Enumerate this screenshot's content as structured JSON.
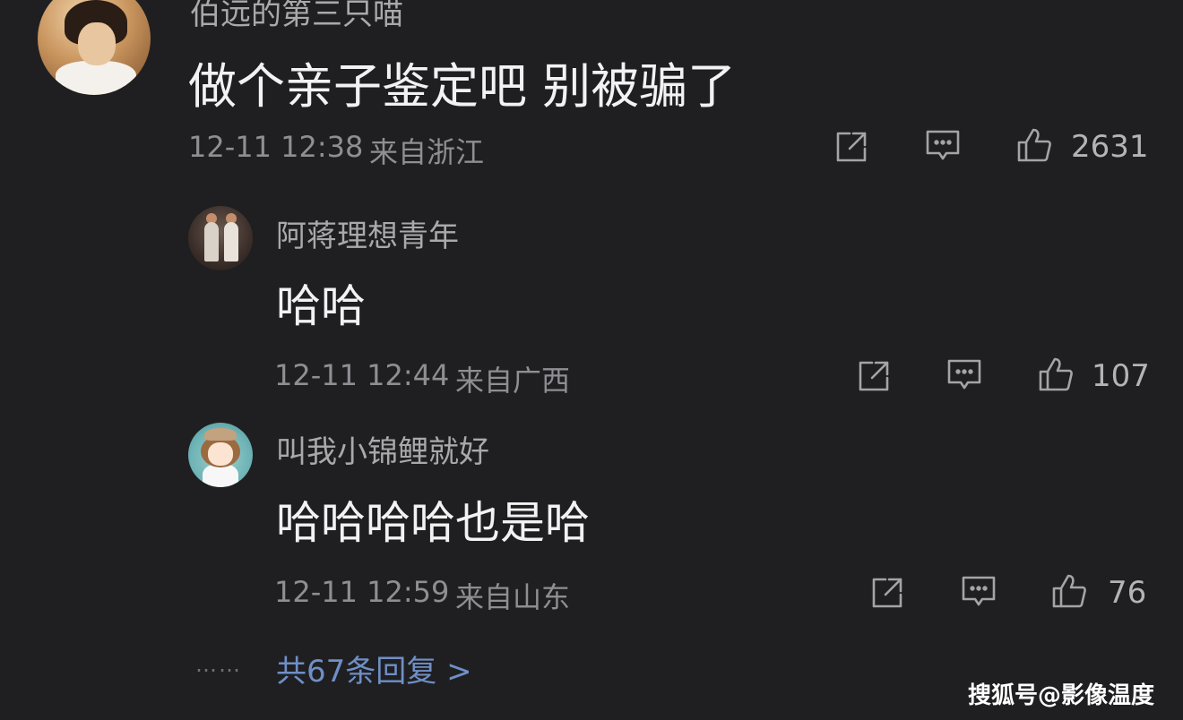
{
  "main_comment": {
    "username": "伯远的第三只喵",
    "text": "做个亲子鉴定吧 别被骗了",
    "time": "12-11 12:38",
    "location": "来自浙江",
    "likes": "2631"
  },
  "replies": [
    {
      "username": "阿蒋理想青年",
      "text": "哈哈",
      "time": "12-11 12:44",
      "location": "来自广西",
      "likes": "107"
    },
    {
      "username": "叫我小锦鲤就好",
      "text": "哈哈哈哈也是哈",
      "time": "12-11 12:59",
      "location": "来自山东",
      "likes": "76"
    }
  ],
  "footer": {
    "dots": "……",
    "more_replies": "共67条回复 >"
  },
  "watermark": "搜狐号@影像温度",
  "icons": {
    "share": "share-icon",
    "reply": "comment-icon",
    "like": "thumbs-up-icon"
  },
  "colors": {
    "background": "#1f1f21",
    "link": "#6f8fc6",
    "meta": "#8e8e93"
  }
}
